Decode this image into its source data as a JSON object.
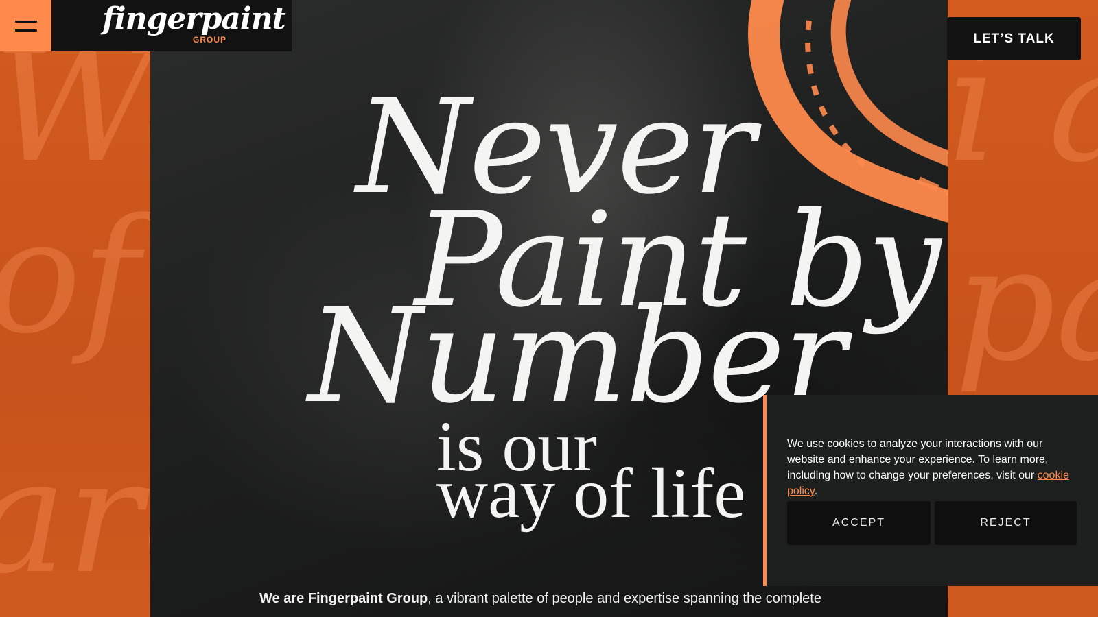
{
  "header": {
    "menu_icon": "hamburger-menu-icon",
    "logo_word": "fingerpaint",
    "logo_sub": "GROUP",
    "cta_label": "LET’S TALK"
  },
  "background": {
    "script_left": [
      "We",
      "of li",
      "are"
    ],
    "script_right": [
      "i a",
      "pai"
    ]
  },
  "hero": {
    "line1": "Never",
    "line2": "Paint by",
    "line3": "Number",
    "line4": "is our",
    "line5": "way of life",
    "intro_bold": "We are Fingerpaint Group",
    "intro_rest": ", a vibrant palette of people and expertise spanning the complete"
  },
  "cookie_banner": {
    "text": "We use cookies to analyze your interactions with our website and enhance your experience. To learn more, including how to change your preferences, visit our ",
    "link": "cookie policy",
    "text_end": ".",
    "accept_label": "ACCEPT",
    "reject_label": "REJECT"
  },
  "colors": {
    "brand_orange": "#ff8a4c",
    "panel_orange": "#c9561f",
    "dark": "#121212"
  }
}
